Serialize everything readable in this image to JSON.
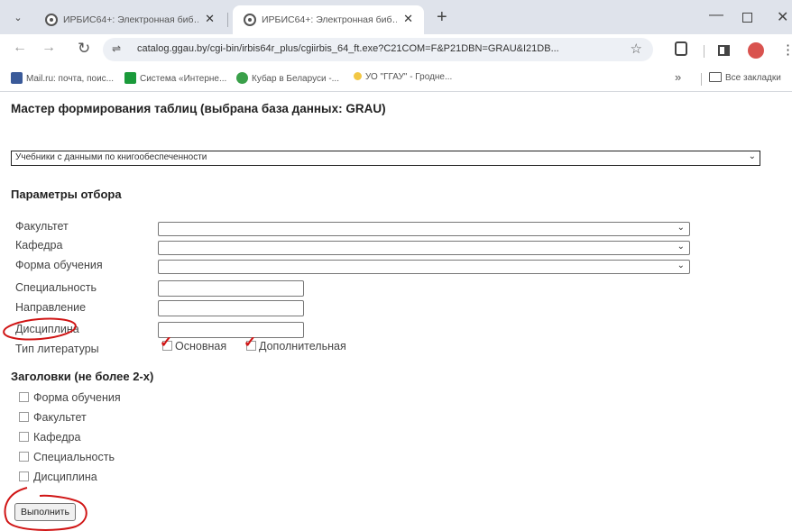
{
  "browser": {
    "tabs": [
      {
        "title": "ИРБИС64+: Электронная биб…",
        "active": false
      },
      {
        "title": "ИРБИС64+: Электронная биб…",
        "active": true
      }
    ],
    "new_tab": "+",
    "url": "catalog.ggau.by/cgi-bin/irbis64r_plus/cgiirbis_64_ft.exe?C21COM=F&P21DBN=GRAU&I21DB...",
    "bookmarks": [
      "Mail.ru: почта, поис...",
      "Система «Интерне...",
      "Кубар в Беларуси -...",
      "УО \"ГГАУ\" - Гродне..."
    ],
    "bookmarks_more": "»",
    "bookmarks_folder": "Все закладки",
    "avatar_color": "#d9534f"
  },
  "page": {
    "title": "Мастер формирования таблиц (выбрана база данных: GRAU)",
    "report_type": "Учебники с данными по книгообеспеченности",
    "params_title": "Параметры отбора",
    "fields": {
      "faculty": "Факультет",
      "department": "Кафедра",
      "study_form": "Форма обучения",
      "specialty": "Специальность",
      "direction": "Направление",
      "discipline": "Дисциплина",
      "lit_type": "Тип литературы"
    },
    "lit_types": [
      {
        "label": "Основная",
        "checked": true
      },
      {
        "label": "Дополнительная",
        "checked": true
      }
    ],
    "headers_title": "Заголовки (не более 2-х)",
    "header_options": [
      "Форма обучения",
      "Факультет",
      "Кафедра",
      "Специальность",
      "Дисциплина"
    ],
    "run_button": "Выполнить",
    "annotation_color": "#d01515"
  }
}
